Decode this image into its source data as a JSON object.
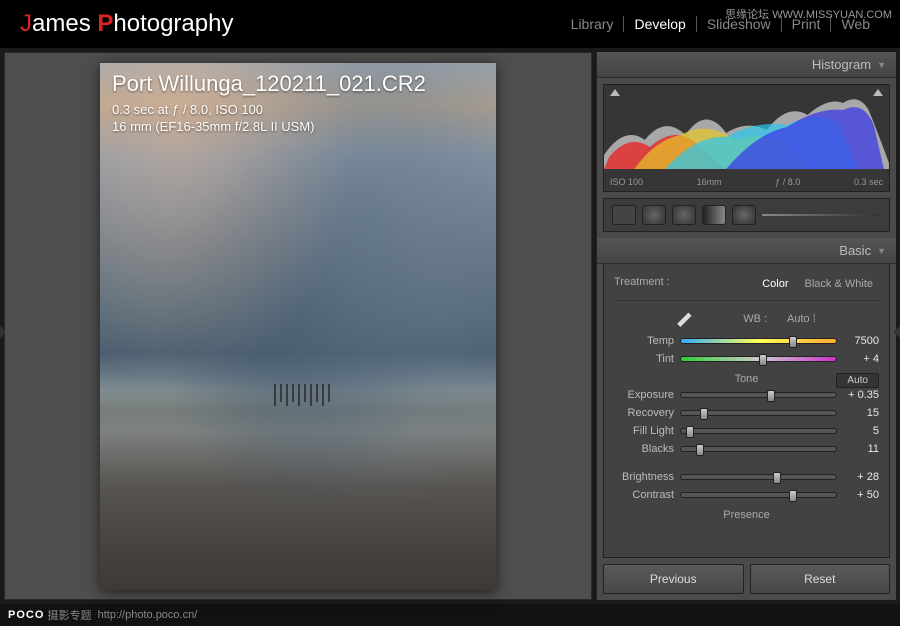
{
  "watermark": {
    "top": "思缘论坛 WWW.MISSYUAN.COM"
  },
  "brand": {
    "j": "J",
    "ames": "ames ",
    "p": "P",
    "rest": "hotography"
  },
  "modules": [
    "Library",
    "Develop",
    "Slideshow",
    "Print",
    "Web"
  ],
  "active_module": 1,
  "photo": {
    "filename": "Port Willunga_120211_021.CR2",
    "exif1": "0.3 sec at ƒ / 8.0, ISO 100",
    "exif2": "16 mm (EF16-35mm f/2.8L II USM)"
  },
  "panels": {
    "histogram": "Histogram",
    "basic": "Basic"
  },
  "histo_labels": {
    "iso": "ISO 100",
    "fl": "16mm",
    "ap": "ƒ / 8.0",
    "sh": "0.3 sec"
  },
  "treatment": {
    "label": "Treatment :",
    "color": "Color",
    "bw": "Black & White"
  },
  "wb": {
    "label": "WB :",
    "value": "Auto"
  },
  "sliders": {
    "temp": {
      "label": "Temp",
      "value": "7500",
      "pos": 72
    },
    "tint": {
      "label": "Tint",
      "value": "+ 4",
      "pos": 53
    },
    "tone_head": "Tone",
    "tone_auto": "Auto",
    "exposure": {
      "label": "Exposure",
      "value": "+ 0.35",
      "pos": 58
    },
    "recovery": {
      "label": "Recovery",
      "value": "15",
      "pos": 15
    },
    "filllight": {
      "label": "Fill Light",
      "value": "5",
      "pos": 6
    },
    "blacks": {
      "label": "Blacks",
      "value": "11",
      "pos": 12
    },
    "brightness": {
      "label": "Brightness",
      "value": "+ 28",
      "pos": 62
    },
    "contrast": {
      "label": "Contrast",
      "value": "+ 50",
      "pos": 72
    },
    "presence": "Presence"
  },
  "buttons": {
    "prev": "Previous",
    "reset": "Reset"
  },
  "footer": {
    "brand": "POCO",
    "sub": "摄影专题",
    "url": "http://photo.poco.cn/"
  }
}
